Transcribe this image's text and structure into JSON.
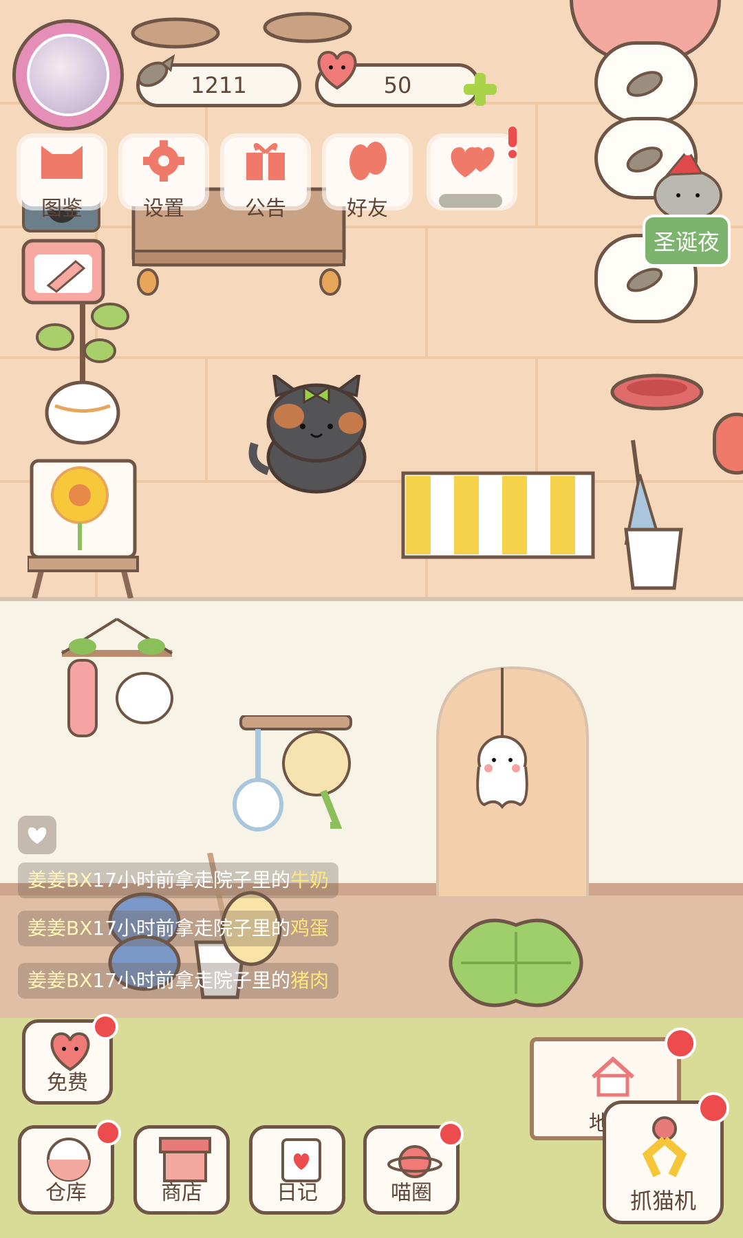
{
  "currency": {
    "fish": "1211",
    "hearts": "50"
  },
  "menu": [
    {
      "label": "图鉴",
      "icon": "cat-head-icon"
    },
    {
      "label": "设置",
      "icon": "gear-icon"
    },
    {
      "label": "公告",
      "icon": "gift-icon"
    },
    {
      "label": "好友",
      "icon": "friends-icon"
    },
    {
      "label": "",
      "icon": "hearts-icon"
    }
  ],
  "event_button": "圣诞夜",
  "feed": [
    {
      "user": "姜姜BX",
      "text": "17小时前拿走院子里的",
      "item": "牛奶"
    },
    {
      "user": "姜姜BX",
      "text": "17小时前拿走院子里的",
      "item": "鸡蛋"
    },
    {
      "user": "姜姜BX",
      "text": "17小时前拿走院子里的",
      "item": "猪肉"
    }
  ],
  "bottom": {
    "free": "免费",
    "warehouse": "仓库",
    "shop": "商店",
    "diary": "日记",
    "meow_circle": "喵圈",
    "claw_machine": "抓猫机",
    "sign_text": "地"
  },
  "colors": {
    "accent_green": "#7db46d",
    "notification_red": "#ec4c4c",
    "outline_brown": "#6e5546"
  }
}
